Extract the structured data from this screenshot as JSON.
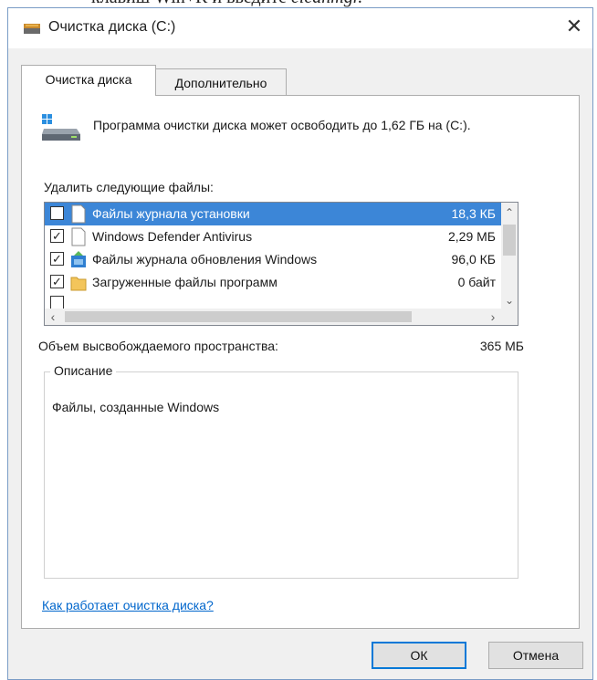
{
  "cut_text": {
    "before": "клавиш Win+R и введите ",
    "italic": "cleanmgr."
  },
  "window": {
    "title": "Очистка диска  (C:)",
    "close_glyph": "✕"
  },
  "tabs": [
    {
      "label": "Очистка диска",
      "active": true
    },
    {
      "label": "Дополнительно",
      "active": false
    }
  ],
  "header": {
    "text": "Программа очистки диска может освободить до 1,62 ГБ на  (C:)."
  },
  "files": {
    "label": "Удалить следующие файлы:",
    "items": [
      {
        "label": "Файлы журнала установки",
        "size": "18,3 КБ",
        "checked": false,
        "selected": true,
        "icon": "blank-file-icon"
      },
      {
        "label": "Windows Defender Antivirus",
        "size": "2,29 МБ",
        "checked": true,
        "selected": false,
        "icon": "blank-file-icon"
      },
      {
        "label": "Файлы журнала обновления Windows",
        "size": "96,0 КБ",
        "checked": true,
        "selected": false,
        "icon": "windows-update-icon"
      },
      {
        "label": "Загруженные файлы программ",
        "size": "0 байт",
        "checked": true,
        "selected": false,
        "icon": "folder-icon"
      }
    ]
  },
  "space": {
    "label": "Объем высвобождаемого пространства:",
    "value": "365 МБ"
  },
  "description": {
    "legend": "Описание",
    "text": "Файлы, созданные Windows"
  },
  "help_link": "Как работает очистка диска?",
  "buttons": {
    "ok": "ОК",
    "cancel": "Отмена"
  },
  "colors": {
    "selection": "#3c86d7",
    "link": "#0066cc",
    "default_button_border": "#0078d7"
  }
}
